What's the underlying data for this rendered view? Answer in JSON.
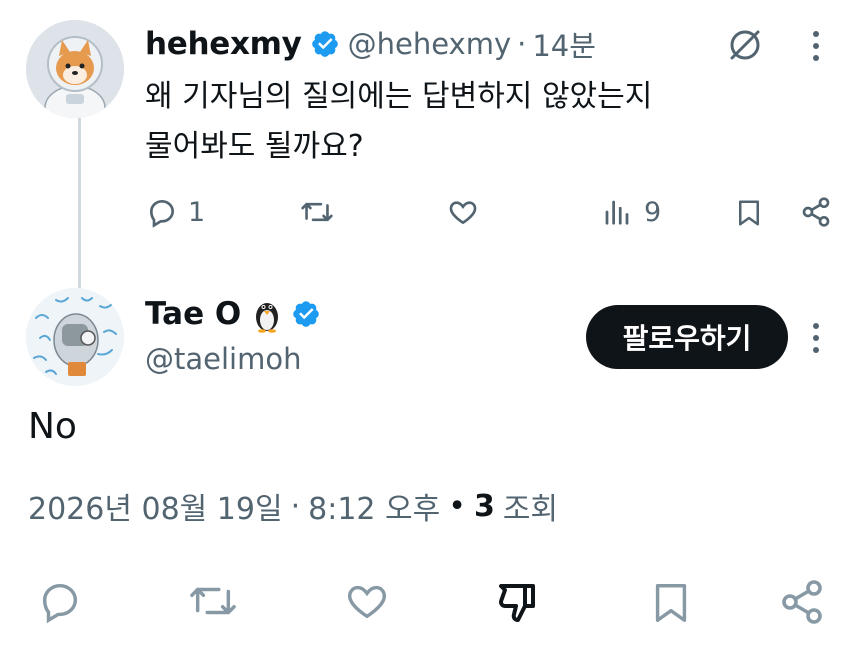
{
  "colors": {
    "text": "#0f1419",
    "secondary": "#536471",
    "verified": "#1d9bf0",
    "thread_line": "#cfd9de",
    "follow_bg": "#0f1419"
  },
  "tweet1": {
    "display_name": "hehexmy",
    "handle": "@hehexmy",
    "separator": "·",
    "time": "14분",
    "body_line1": "왜 기자님의 질의에는 답변하지 않았는지",
    "body_line2": "물어봐도 될까요?",
    "reply_count": "1",
    "view_count": "9",
    "icons": [
      "verified-badge-icon",
      "grok-icon",
      "more-icon",
      "reply-icon",
      "retweet-icon",
      "like-icon",
      "views-icon",
      "bookmark-icon",
      "share-icon"
    ]
  },
  "tweet2": {
    "display_name": "Tae O",
    "handle": "@taelimoh",
    "follow_label": "팔로우하기",
    "body": "No",
    "date": "2026년 08월 19일",
    "dot": "·",
    "time": "8:12 오후",
    "bullet": "•",
    "views_count": "3",
    "views_label": "조회",
    "icons": [
      "penguin-icon",
      "verified-badge-icon",
      "more-icon",
      "reply-icon",
      "retweet-icon",
      "like-icon",
      "dislike-icon",
      "bookmark-icon",
      "share-icon"
    ]
  }
}
